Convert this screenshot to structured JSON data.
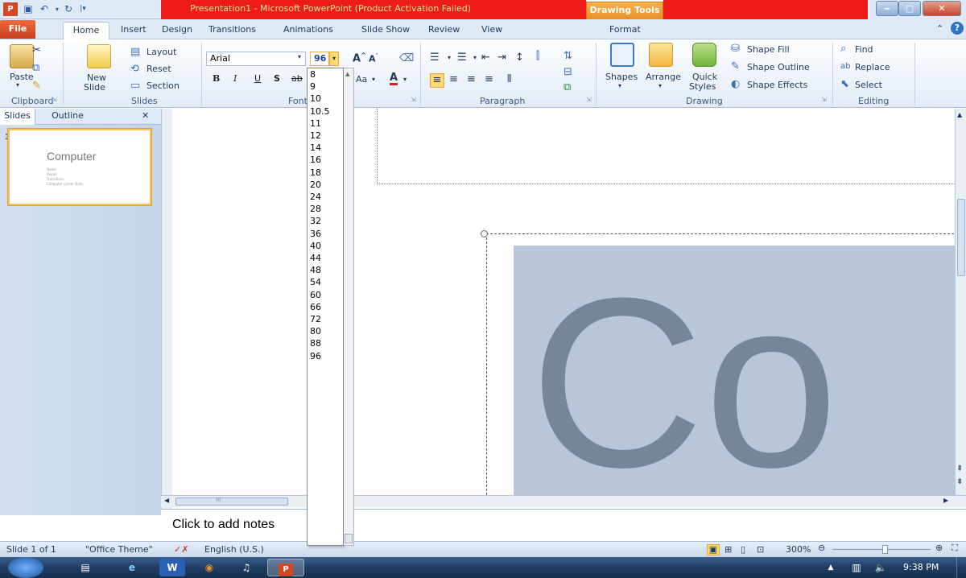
{
  "window": {
    "title": "Presentation1 - Microsoft PowerPoint (Product Activation Failed)",
    "contextual_tab": "Drawing Tools",
    "controls": [
      "minimize",
      "maximize",
      "close"
    ]
  },
  "tabs": {
    "file": "File",
    "items": [
      "Home",
      "Insert",
      "Design",
      "Transitions",
      "Animations",
      "Slide Show",
      "Review",
      "View",
      "Format"
    ]
  },
  "ribbon": {
    "clipboard": {
      "label": "Clipboard",
      "paste": "Paste"
    },
    "slides": {
      "label": "Slides",
      "new_slide_line1": "New",
      "new_slide_line2": "Slide",
      "layout": "Layout",
      "reset": "Reset",
      "section": "Section"
    },
    "font": {
      "label": "Font",
      "font_name": "Arial",
      "font_size": "96",
      "bold": "B",
      "italic": "I",
      "underline": "U",
      "shadow": "S",
      "strike": "ab",
      "change_case": "Aa",
      "color_letter": "A"
    },
    "paragraph": {
      "label": "Paragraph"
    },
    "drawing": {
      "label": "Drawing",
      "shapes": "Shapes",
      "arrange": "Arrange",
      "quick_styles_line1": "Quick",
      "quick_styles_line2": "Styles",
      "shape_fill": "Shape Fill",
      "shape_outline": "Shape Outline",
      "shape_effects": "Shape Effects"
    },
    "editing": {
      "label": "Editing",
      "find": "Find",
      "replace": "Replace",
      "select": "Select"
    }
  },
  "font_size_dropdown": {
    "options": [
      "8",
      "9",
      "10",
      "10.5",
      "11",
      "12",
      "14",
      "16",
      "18",
      "20",
      "24",
      "28",
      "32",
      "36",
      "40",
      "44",
      "48",
      "54",
      "60",
      "66",
      "72",
      "80",
      "88",
      "96"
    ],
    "selected": "96"
  },
  "pane": {
    "tab_slides": "Slides",
    "tab_outline": "Outline",
    "slide_number": "1",
    "thumb_title": "Computer",
    "thumb_lines": [
      "Name",
      "Repair",
      "Transitions",
      "Computer career Data"
    ]
  },
  "editor": {
    "big_text": "Co",
    "scroll_mark": "III"
  },
  "notes": {
    "placeholder": "Click to add notes"
  },
  "status": {
    "slide": "Slide 1 of 1",
    "theme": "\"Office Theme\"",
    "language": "English (U.S.)",
    "zoom": "300%"
  },
  "taskbar": {
    "time": "9:38 PM"
  },
  "colors": {
    "title_red": "#ef1b17",
    "file_tab": "#d95127",
    "drawing_tools": "#f0a040",
    "slide_fill": "#b8c5da",
    "slide_text": "#76859e"
  }
}
